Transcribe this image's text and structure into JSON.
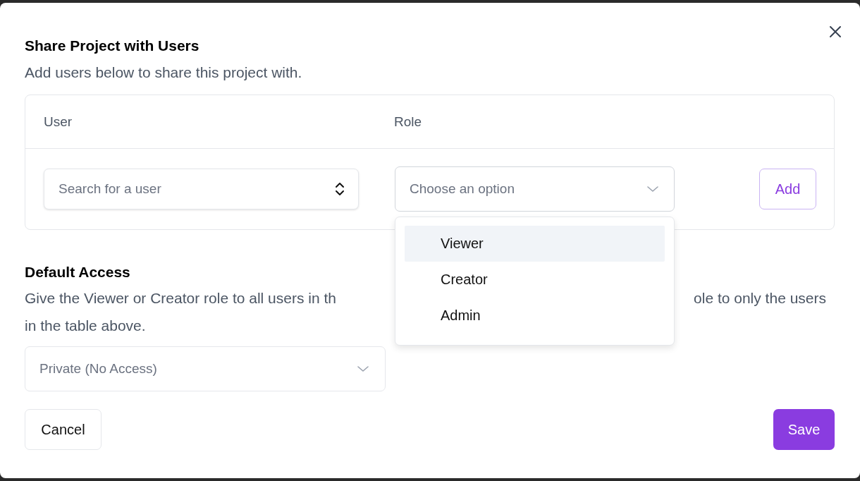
{
  "dialog": {
    "title": "Share Project with Users",
    "subtitle": "Add users below to share this project with."
  },
  "table": {
    "columns": [
      "User",
      "Role"
    ],
    "user_field": {
      "placeholder": "Search for a user"
    },
    "role_field": {
      "placeholder": "Choose an option",
      "expanded": true
    },
    "add_button": "Add"
  },
  "role_menu": [
    {
      "label": "Viewer",
      "highlighted": true
    },
    {
      "label": "Creator",
      "highlighted": false
    },
    {
      "label": "Admin",
      "highlighted": false
    }
  ],
  "default_access": {
    "title": "Default Access",
    "description_visible_left": "Give the Viewer or Creator role to all users in th",
    "description_visible_right": "ole to only the users",
    "description_line_2": "in the table above.",
    "value": "Private (No Access)"
  },
  "buttons": {
    "cancel": "Cancel",
    "save": "Save"
  }
}
